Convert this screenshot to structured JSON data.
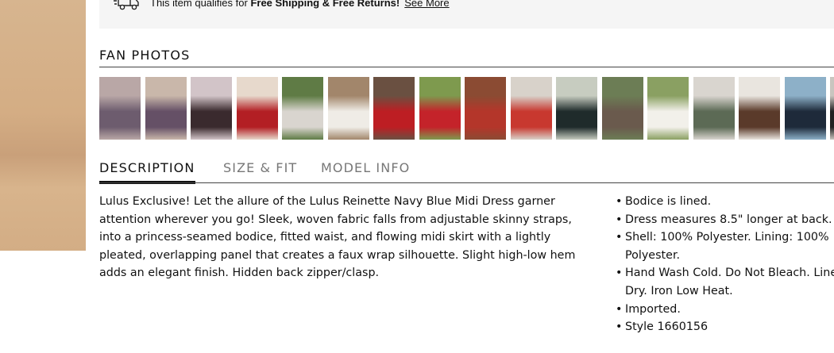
{
  "shipping": {
    "prefix": "This item qualifies for ",
    "bold": "Free Shipping & Free Returns!",
    "link": "See More"
  },
  "fan_photos": {
    "title": "FAN PHOTOS",
    "thumbnails": [
      {
        "icon": "fan-photo-thumbnail",
        "colors": [
          "#b9a7a6",
          "#6d5c6e"
        ]
      },
      {
        "icon": "fan-photo-thumbnail",
        "colors": [
          "#c9b7aa",
          "#655066"
        ]
      },
      {
        "icon": "fan-photo-thumbnail",
        "colors": [
          "#d2c4c8",
          "#3a2a2e"
        ]
      },
      {
        "icon": "fan-photo-thumbnail",
        "colors": [
          "#e7d9cc",
          "#b31f24"
        ]
      },
      {
        "icon": "fan-photo-thumbnail",
        "colors": [
          "#5f7b45",
          "#d9d5cf"
        ]
      },
      {
        "icon": "fan-photo-thumbnail",
        "colors": [
          "#a2866b",
          "#efece6"
        ]
      },
      {
        "icon": "fan-photo-thumbnail",
        "colors": [
          "#6a5041",
          "#bd1e23"
        ]
      },
      {
        "icon": "fan-photo-thumbnail",
        "colors": [
          "#7e9a4e",
          "#c4232a"
        ]
      },
      {
        "icon": "fan-photo-thumbnail",
        "colors": [
          "#8b4b33",
          "#b4362a"
        ]
      },
      {
        "icon": "fan-photo-thumbnail",
        "colors": [
          "#d8d2ca",
          "#c8382f"
        ]
      },
      {
        "icon": "fan-photo-thumbnail",
        "colors": [
          "#c7ccc0",
          "#1f2b2b"
        ]
      },
      {
        "icon": "fan-photo-thumbnail",
        "colors": [
          "#6c7d55",
          "#6a5a4d"
        ]
      },
      {
        "icon": "fan-photo-thumbnail",
        "colors": [
          "#8aa062",
          "#f2f0ea"
        ]
      },
      {
        "icon": "fan-photo-thumbnail",
        "colors": [
          "#d9d5cf",
          "#5c6a55"
        ]
      },
      {
        "icon": "fan-photo-thumbnail",
        "colors": [
          "#e9e5df",
          "#5a3a2a"
        ]
      },
      {
        "icon": "fan-photo-thumbnail",
        "colors": [
          "#8db0c8",
          "#1e2a3a"
        ]
      },
      {
        "icon": "fan-photo-thumbnail",
        "colors": [
          "#c9c5bf",
          "#222222"
        ]
      }
    ]
  },
  "tabs": [
    {
      "label": "DESCRIPTION",
      "active": true
    },
    {
      "label": "SIZE & FIT",
      "active": false
    },
    {
      "label": "MODEL INFO",
      "active": false
    }
  ],
  "description": "Lulus Exclusive! Let the allure of the Lulus Reinette Navy Blue Midi Dress garner attention wherever you go! Sleek, woven fabric falls from adjustable skinny straps, into a princess-seamed bodice, fitted waist, and flowing midi skirt with a lightly pleated, overlapping panel that creates a faux wrap silhouette. Slight high-low hem adds an elegant finish. Hidden back zipper/clasp.",
  "details": [
    "Bodice is lined.",
    "Dress measures 8.5\" longer at back.",
    "Shell: 100% Polyester. Lining: 100% Polyester.",
    "Hand Wash Cold. Do Not Bleach. Line Dry. Iron Low Heat.",
    "Imported.",
    "Style 1660156"
  ],
  "colors": {
    "text": "#111111",
    "muted_tab": "#777777",
    "panel": "#f5f5f5"
  }
}
